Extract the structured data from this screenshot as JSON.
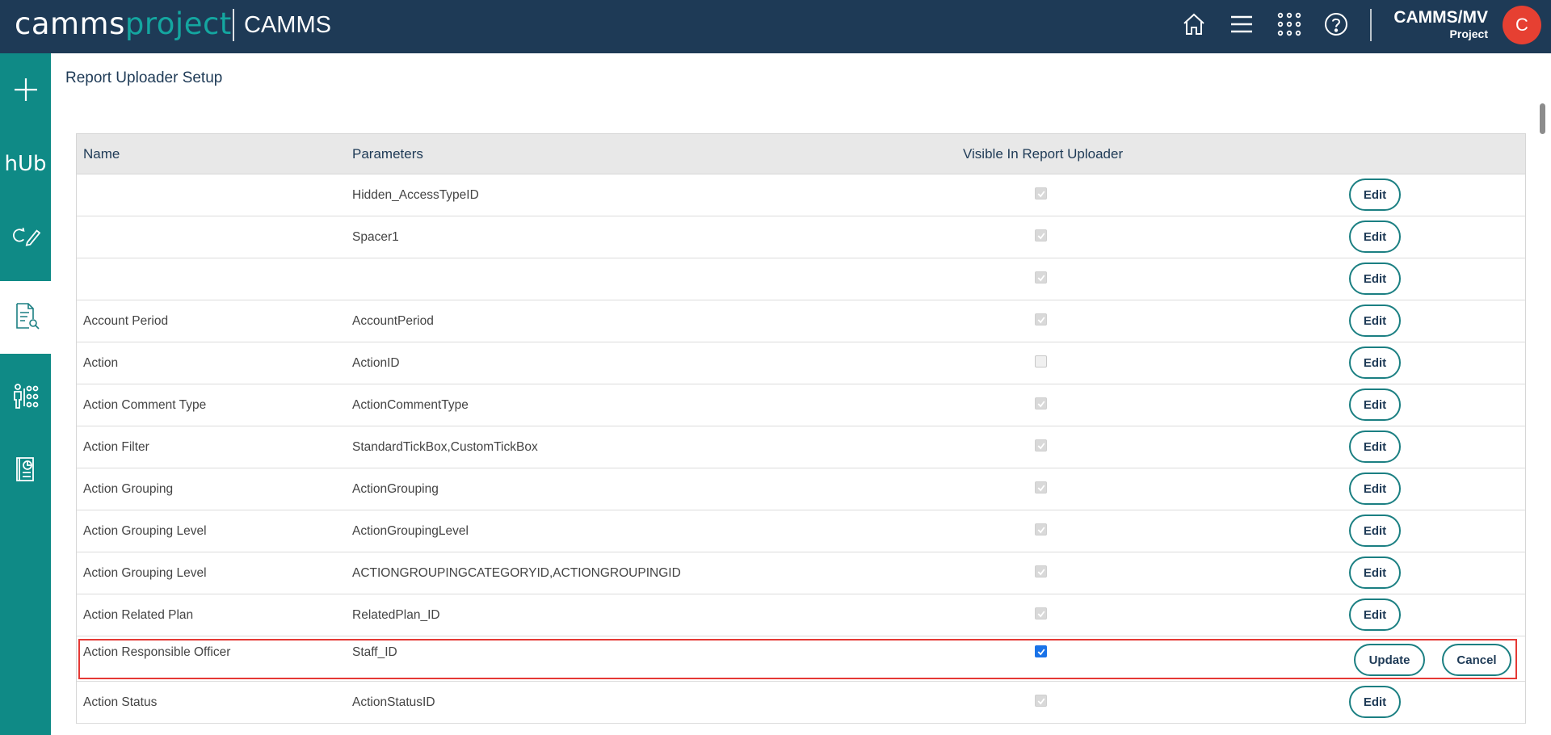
{
  "header": {
    "brand_part1": "camms",
    "brand_part2": "project",
    "app_title": "CAMMS",
    "user_name": "CAMMS/MV",
    "user_sub": "Project",
    "avatar_letter": "C",
    "icons": [
      "home-icon",
      "menu-icon",
      "apps-grid-icon",
      "help-icon"
    ]
  },
  "sidebar": {
    "items": [
      {
        "icon": "plus-icon"
      },
      {
        "icon": "hub-icon",
        "label": "hUb"
      },
      {
        "icon": "refresh-edit-icon"
      },
      {
        "icon": "report-search-icon",
        "active": true
      },
      {
        "icon": "org-chart-icon"
      },
      {
        "icon": "report-book-icon"
      }
    ]
  },
  "page": {
    "title": "Report Uploader Setup"
  },
  "table": {
    "headers": {
      "name": "Name",
      "parameters": "Parameters",
      "visible": "Visible In Report Uploader"
    },
    "edit_label": "Edit",
    "update_label": "Update",
    "cancel_label": "Cancel",
    "rows": [
      {
        "name": "",
        "parameters": "Hidden_AccessTypeID",
        "visible": true
      },
      {
        "name": "",
        "parameters": "Spacer1",
        "visible": true
      },
      {
        "name": "",
        "parameters": "",
        "visible": true
      },
      {
        "name": "Account Period",
        "parameters": "AccountPeriod",
        "visible": true
      },
      {
        "name": "Action",
        "parameters": "ActionID",
        "visible": false
      },
      {
        "name": "Action Comment Type",
        "parameters": "ActionCommentType",
        "visible": true
      },
      {
        "name": "Action Filter",
        "parameters": "StandardTickBox,CustomTickBox",
        "visible": true
      },
      {
        "name": "Action Grouping",
        "parameters": "ActionGrouping",
        "visible": true
      },
      {
        "name": "Action Grouping Level",
        "parameters": "ActionGroupingLevel",
        "visible": true
      },
      {
        "name": "Action Grouping Level",
        "parameters": "ACTIONGROUPINGCATEGORYID,ACTIONGROUPINGID",
        "visible": true
      },
      {
        "name": "Action Related Plan",
        "parameters": "RelatedPlan_ID",
        "visible": true
      },
      {
        "name": "Action Responsible Officer",
        "parameters": "Staff_ID",
        "visible": true,
        "editing": true
      },
      {
        "name": "Action Status",
        "parameters": "ActionStatusID",
        "visible": true
      }
    ]
  }
}
